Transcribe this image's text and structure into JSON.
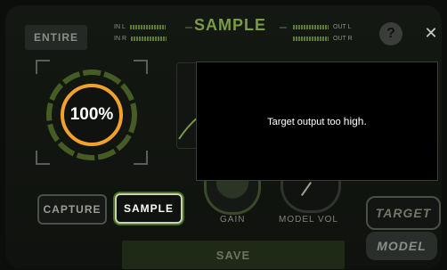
{
  "header": {
    "entire_label": "ENTIRE",
    "title": "SAMPLE",
    "in_left_label": "IN L",
    "in_right_label": "IN R",
    "out_left_label": "OUT L",
    "out_right_label": "OUT R",
    "help_label": "?",
    "close_label": "✕"
  },
  "capture_ring": {
    "percent_label": "100%",
    "progress": 1.0
  },
  "modes": {
    "capture_label": "CAPTURE",
    "sample_label": "SAMPLE",
    "selected": "SAMPLE"
  },
  "knobs": {
    "gain_label": "GAIN",
    "model_vol_label": "MODEL VOL"
  },
  "side_tabs": {
    "target_label": "TARGET",
    "model_label": "MODEL"
  },
  "save_label": "SAVE",
  "dialog": {
    "message_prefix": "Target output too",
    "message_emphasis": "high."
  },
  "colors": {
    "accent_green": "#7a9a45",
    "ring_orange": "#f2a22b",
    "ring_green": "#7a9a45"
  }
}
